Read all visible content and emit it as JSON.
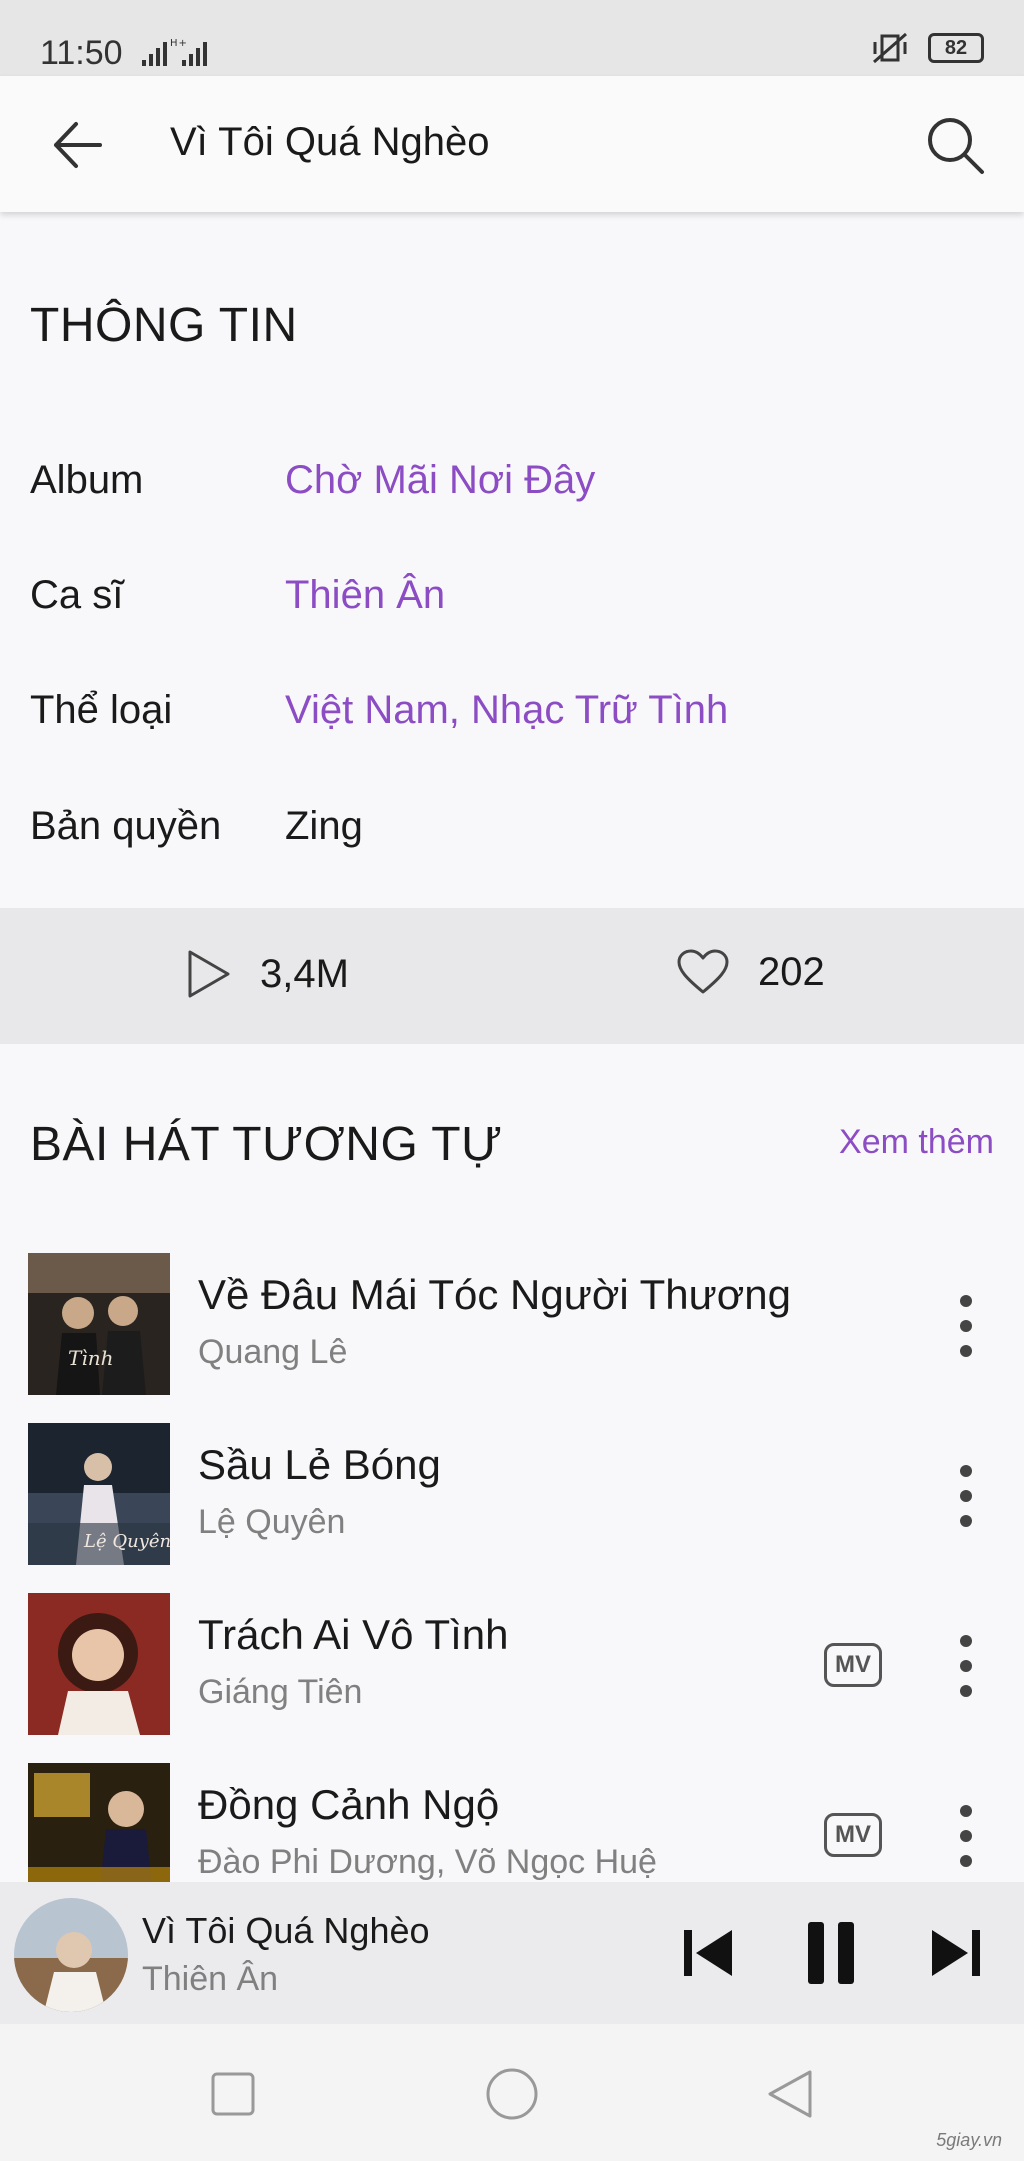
{
  "status_bar": {
    "time": "11:50",
    "signal": "..ıl ᴴ⁺..ıl",
    "battery": "82"
  },
  "app_bar": {
    "title": "Vì Tôi Quá Nghèo"
  },
  "info": {
    "heading": "THÔNG TIN",
    "rows": [
      {
        "label": "Album",
        "value": "Chờ Mãi Nơi Đây"
      },
      {
        "label": "Ca sĩ",
        "value": "Thiên Ân"
      },
      {
        "label": "Thể loại",
        "value": "Việt Nam, Nhạc Trữ Tình"
      },
      {
        "label": "Bản quyền",
        "value": "Zing"
      }
    ]
  },
  "stats": {
    "plays": "3,4M",
    "likes": "202"
  },
  "similar": {
    "heading": "BÀI HÁT TƯƠNG TỰ",
    "more_label": "Xem thêm",
    "mv_label": "MV",
    "songs": [
      {
        "title": "Về Đâu Mái Tóc Người Thương",
        "artist": "Quang Lê",
        "has_mv": false
      },
      {
        "title": "Sầu Lẻ Bóng",
        "artist": "Lệ Quyên",
        "has_mv": false
      },
      {
        "title": "Trách Ai Vô Tình",
        "artist": "Giáng Tiên",
        "has_mv": true
      },
      {
        "title": "Đồng Cảnh Ngộ",
        "artist": "Đào Phi Dương, Võ Ngọc Huệ",
        "has_mv": true
      }
    ]
  },
  "player": {
    "title": "Vì Tôi Quá Nghèo",
    "artist": "Thiên Ân"
  },
  "watermark": "5giay.vn",
  "colors": {
    "accent": "#8c4cc4",
    "secondary_text": "#808080"
  }
}
